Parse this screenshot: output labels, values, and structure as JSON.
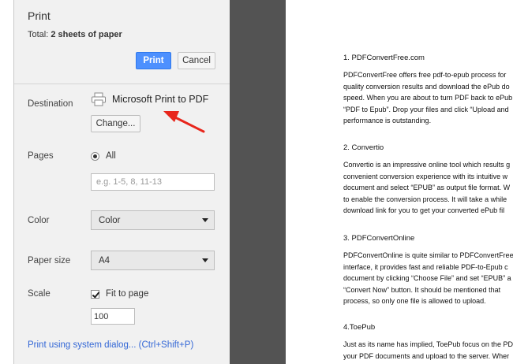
{
  "print_panel": {
    "title": "Print",
    "total_prefix": "Total: ",
    "total_value": "2 sheets of paper",
    "print_button": "Print",
    "cancel_button": "Cancel"
  },
  "destination": {
    "label": "Destination",
    "printer_name": "Microsoft Print to PDF",
    "change_button": "Change..."
  },
  "pages": {
    "label": "Pages",
    "all_label": "All",
    "range_placeholder": "e.g. 1-5, 8, 11-13"
  },
  "color": {
    "label": "Color",
    "value": "Color"
  },
  "paper_size": {
    "label": "Paper size",
    "value": "A4"
  },
  "scale": {
    "label": "Scale",
    "fit_label": "Fit to page",
    "value": "100"
  },
  "system_dialog_link": "Print using system dialog... (Ctrl+Shift+P)",
  "colors": {
    "primary_button": "#4d90fe",
    "link": "#3367d6",
    "annotation_arrow": "#e8261c",
    "preview_background": "#535353"
  },
  "document": {
    "sections": [
      {
        "heading": "1. PDFConvertFree.com",
        "lines": [
          "PDFConvertFree offers free pdf-to-epub process for",
          "quality conversion results and download the ePub do",
          "speed. When you are about to turn PDF back to ePub",
          "“PDF to Epub”. Drop your files and click “Upload and",
          "performance is outstanding."
        ]
      },
      {
        "heading": "2. Convertio",
        "lines": [
          "Convertio is an impressive online tool which results g",
          "convenient conversion experience with its intuitive w",
          "document and select “EPUB” as output file format. W",
          "to enable the conversion process. It will take a while",
          "download link for you to get your converted ePub fil"
        ]
      },
      {
        "heading": "3. PDFConvertOnline",
        "lines": [
          "PDFConvertOnline is quite similar to PDFConvertFree",
          "interface, it provides fast and reliable PDF-to-Epub c",
          "document by clicking “Choose File” and set “EPUB” a",
          "“Convert Now” button. It should be mentioned that",
          "process, so only one file is allowed to upload."
        ]
      },
      {
        "heading": "4.ToePub",
        "lines": [
          "Just as its name has implied, ToePub focus on the PD",
          "your PDF documents and upload to the server. Wher"
        ]
      }
    ]
  }
}
